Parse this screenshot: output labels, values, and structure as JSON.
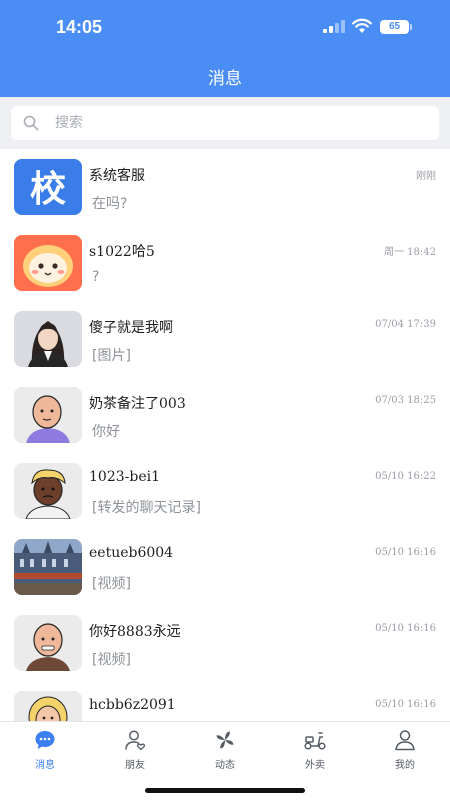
{
  "status_bar": {
    "time": "14:05",
    "battery": "65"
  },
  "header": {
    "title": "消息"
  },
  "search": {
    "placeholder": "搜索"
  },
  "chats": [
    {
      "name": "系统客服",
      "preview": "在吗?",
      "time": "刚刚",
      "avatar_text": "校"
    },
    {
      "name": "s1022哈5",
      "preview": "?",
      "time": "周一 18:42"
    },
    {
      "name": "傻子就是我啊",
      "preview": "[图片]",
      "time": "07/04 17:39"
    },
    {
      "name": "奶茶备注了003",
      "preview": "你好",
      "time": "07/03 18:25"
    },
    {
      "name": "1023-bei1",
      "preview": "[转发的聊天记录]",
      "time": "05/10 16:22"
    },
    {
      "name": "eetueb6004",
      "preview": "[视频]",
      "time": "05/10 16:16"
    },
    {
      "name": "你好8883永远",
      "preview": "[视频]",
      "time": "05/10 16:16"
    },
    {
      "name": "hcbb6z2091",
      "preview": "",
      "time": "05/10 16:16"
    }
  ],
  "tabs": [
    {
      "label": "消息",
      "icon": "chat-bubble-icon",
      "active": true
    },
    {
      "label": "朋友",
      "icon": "friends-icon",
      "active": false
    },
    {
      "label": "动态",
      "icon": "pinwheel-icon",
      "active": false
    },
    {
      "label": "外卖",
      "icon": "scooter-icon",
      "active": false
    },
    {
      "label": "我的",
      "icon": "profile-icon",
      "active": false
    }
  ],
  "colors": {
    "header": "#4a8ef5",
    "accent": "#3b7ff0",
    "background": "#eef0f3"
  }
}
